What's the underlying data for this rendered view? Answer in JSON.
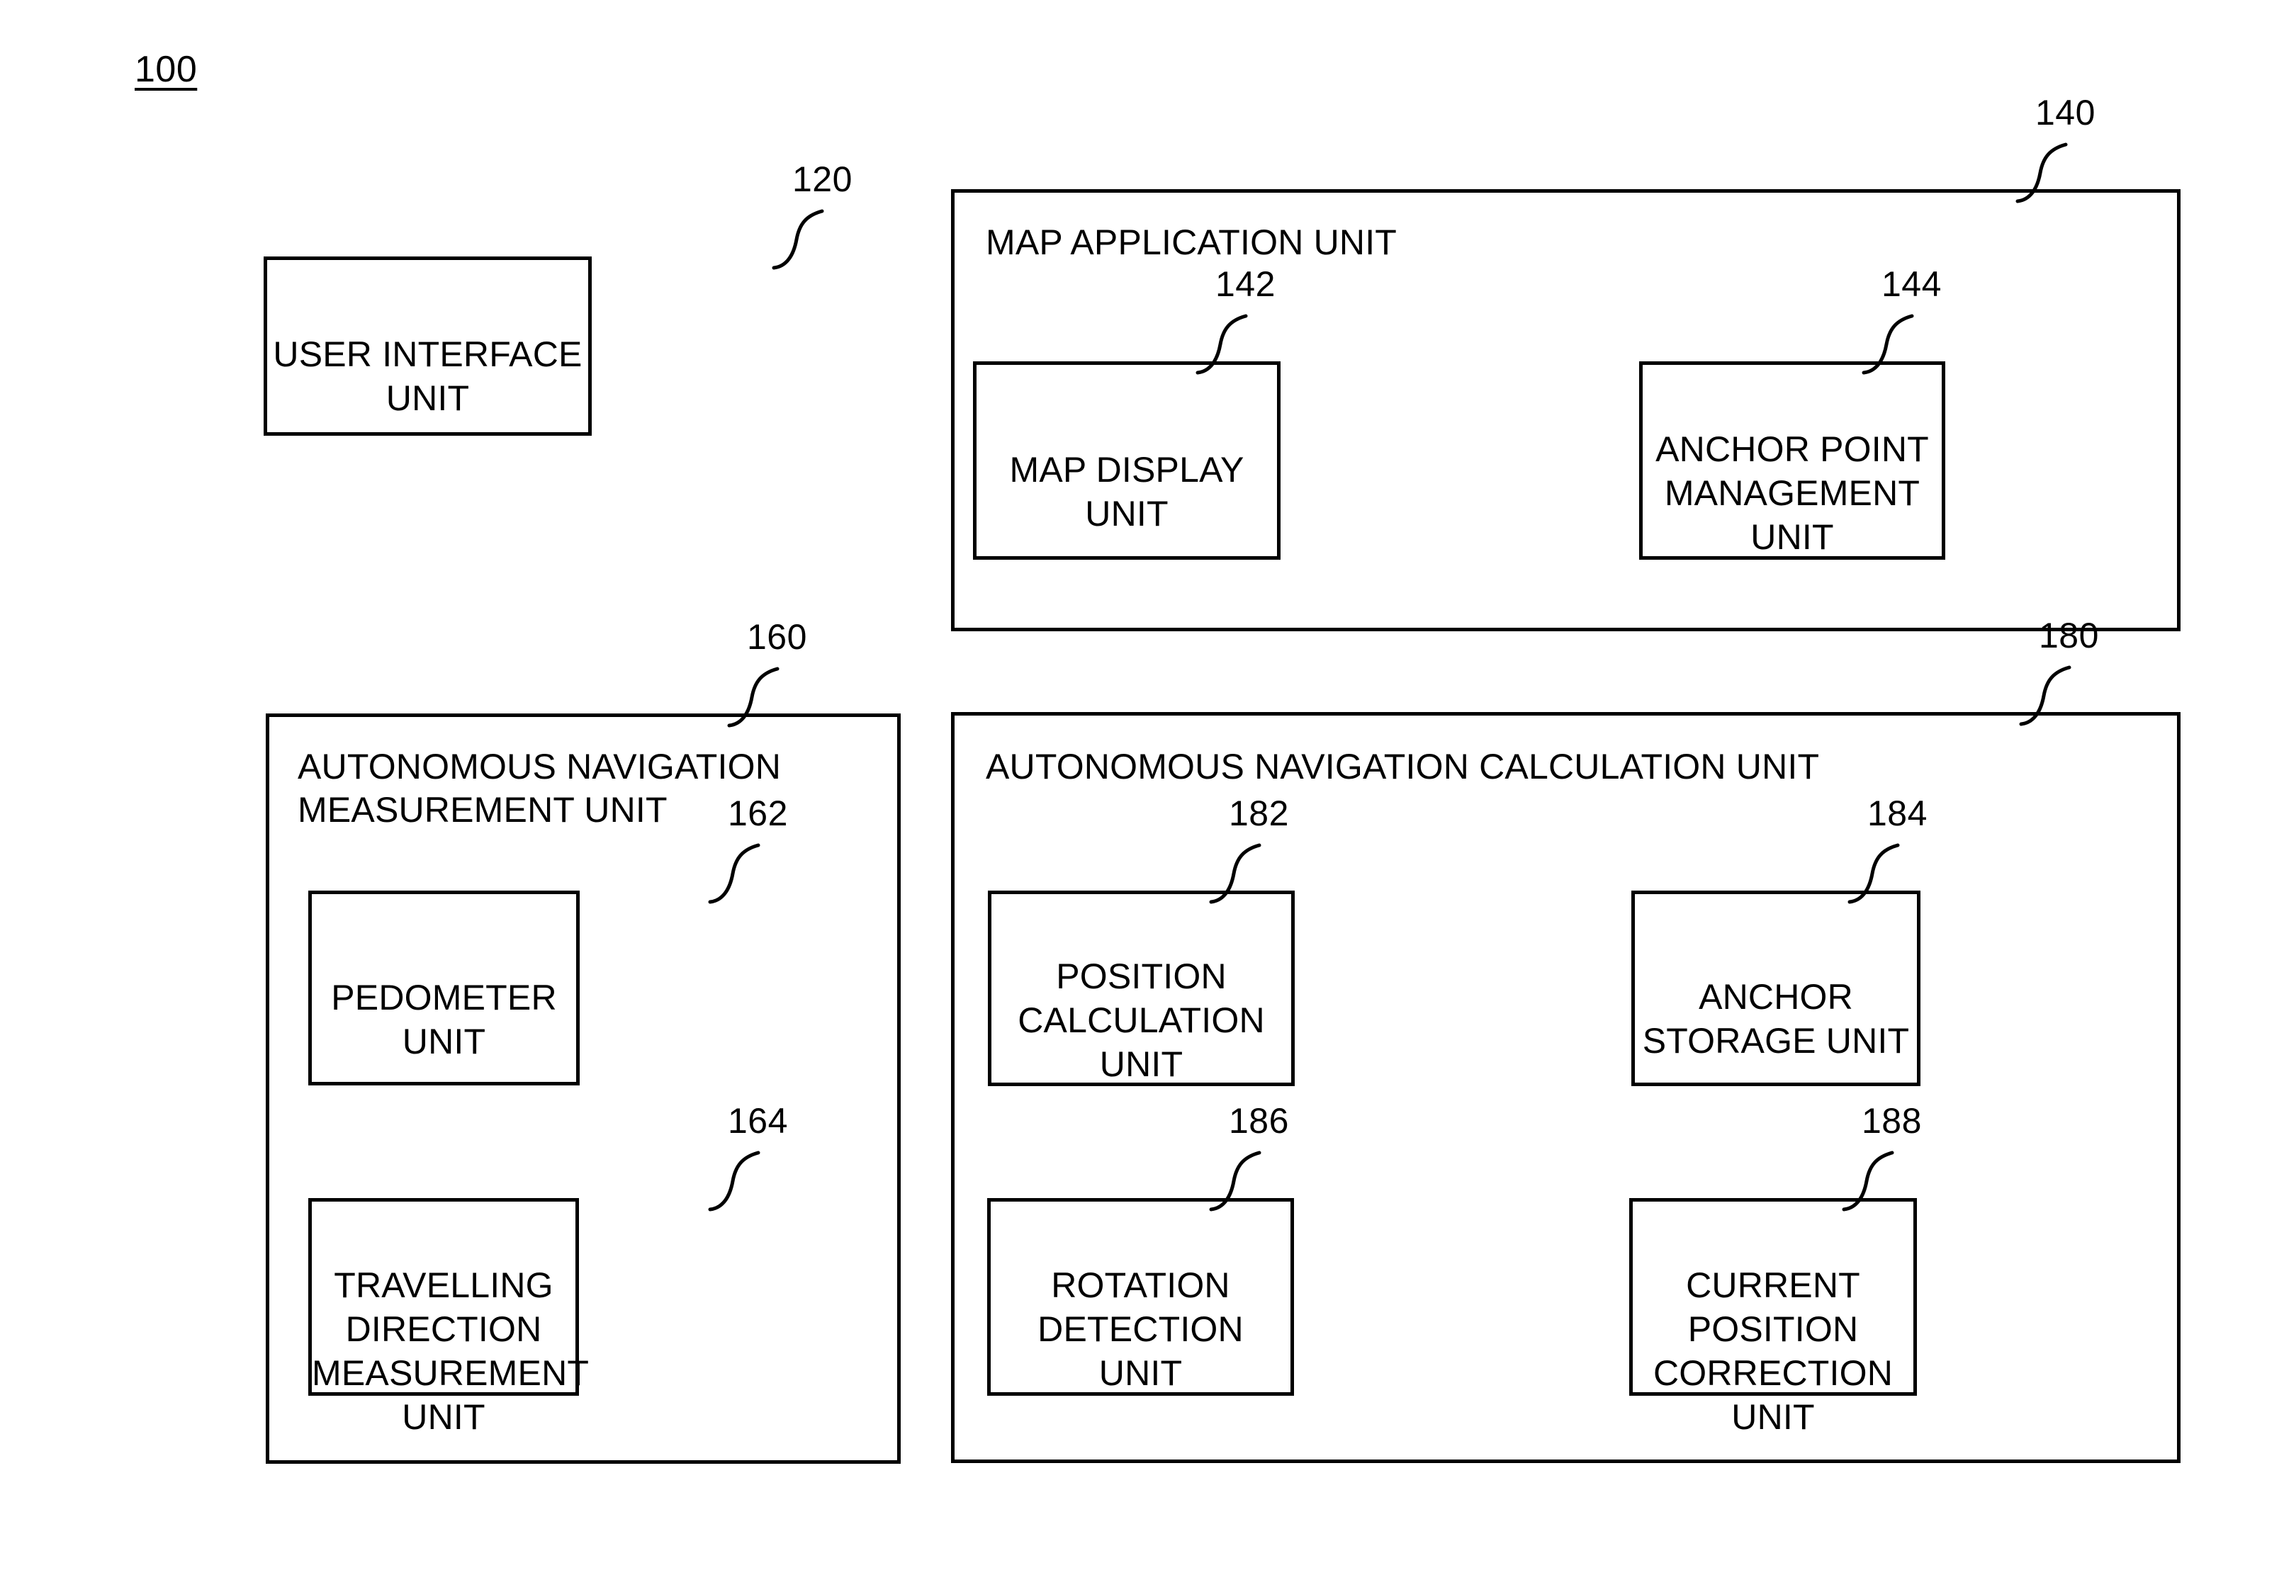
{
  "figure": {
    "id_label": "100",
    "blocks": [
      {
        "ref": "120",
        "title": "USER INTERFACE UNIT",
        "role": "user-interface-unit"
      },
      {
        "ref": "140",
        "title": "MAP APPLICATION UNIT",
        "role": "map-application-unit"
      },
      {
        "ref": "142",
        "title": "MAP DISPLAY UNIT",
        "role": "map-display-unit"
      },
      {
        "ref": "144",
        "title": "ANCHOR POINT\nMANAGEMENT UNIT",
        "role": "anchor-point-management-unit"
      },
      {
        "ref": "160",
        "title": "AUTONOMOUS NAVIGATION\nMEASUREMENT UNIT",
        "role": "autonomous-navigation-measurement-unit"
      },
      {
        "ref": "162",
        "title": "PEDOMETER UNIT",
        "role": "pedometer-unit"
      },
      {
        "ref": "164",
        "title": "TRAVELLING DIRECTION\nMEASUREMENT UNIT",
        "role": "travelling-direction-measurement-unit"
      },
      {
        "ref": "180",
        "title": "AUTONOMOUS NAVIGATION CALCULATION UNIT",
        "role": "autonomous-navigation-calculation-unit"
      },
      {
        "ref": "182",
        "title": "POSITION\nCALCULATION UNIT",
        "role": "position-calculation-unit"
      },
      {
        "ref": "184",
        "title": "ANCHOR STORAGE UNIT",
        "role": "anchor-storage-unit"
      },
      {
        "ref": "186",
        "title": "ROTATION DETECTION\nUNIT",
        "role": "rotation-detection-unit"
      },
      {
        "ref": "188",
        "title": "CURRENT POSITION\nCORRECTION UNIT",
        "role": "current-position-correction-unit"
      }
    ]
  },
  "colors": {
    "stroke": "#000000",
    "background": "#ffffff"
  }
}
